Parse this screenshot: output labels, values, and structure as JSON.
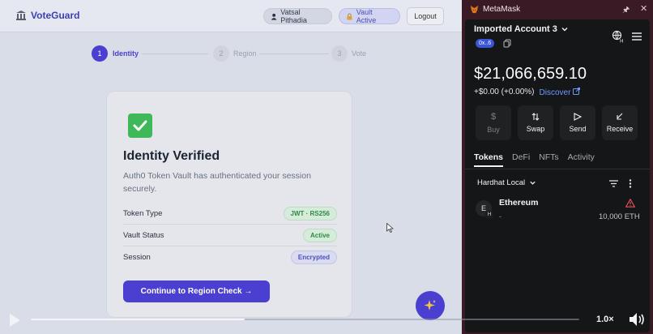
{
  "app": {
    "brand": "VoteGuard",
    "user_pill": "Vatsal Pithadia",
    "vault_pill": "Vault Active",
    "logout": "Logout",
    "steps": [
      {
        "num": "1",
        "label": "Identity",
        "active": true
      },
      {
        "num": "2",
        "label": "Region",
        "active": false
      },
      {
        "num": "3",
        "label": "Vote",
        "active": false
      }
    ],
    "card": {
      "title": "Identity Verified",
      "description": "Auth0 Token Vault has authenticated your session securely.",
      "rows": [
        {
          "label": "Token Type",
          "value": "JWT · RS256"
        },
        {
          "label": "Vault Status",
          "value": "Active"
        },
        {
          "label": "Session",
          "value": "Encrypted"
        }
      ],
      "cta": "Continue to Region Check →"
    },
    "colors": {
      "accent": "#4a3fd0",
      "success": "#3fb85a"
    }
  },
  "player": {
    "speed": "1.0×",
    "progress": 0.39
  },
  "metamask": {
    "title": "MetaMask",
    "account": "Imported Account 3",
    "address_tag": "0x..6",
    "balance": "$21,066,659.10",
    "change": "+$0.00 (+0.00%)",
    "discover": "Discover",
    "actions": [
      {
        "label": "Buy",
        "icon": "dollar-icon",
        "enabled": false
      },
      {
        "label": "Swap",
        "icon": "swap-icon",
        "enabled": true
      },
      {
        "label": "Send",
        "icon": "send-icon",
        "enabled": true
      },
      {
        "label": "Receive",
        "icon": "receive-icon",
        "enabled": true
      }
    ],
    "tabs": [
      "Tokens",
      "DeFi",
      "NFTs",
      "Activity"
    ],
    "network": "Hardhat Local",
    "token": {
      "avatar": "E",
      "badge": "H",
      "name": "Ethereum",
      "sub": "-",
      "amount": "10,000 ETH"
    }
  }
}
